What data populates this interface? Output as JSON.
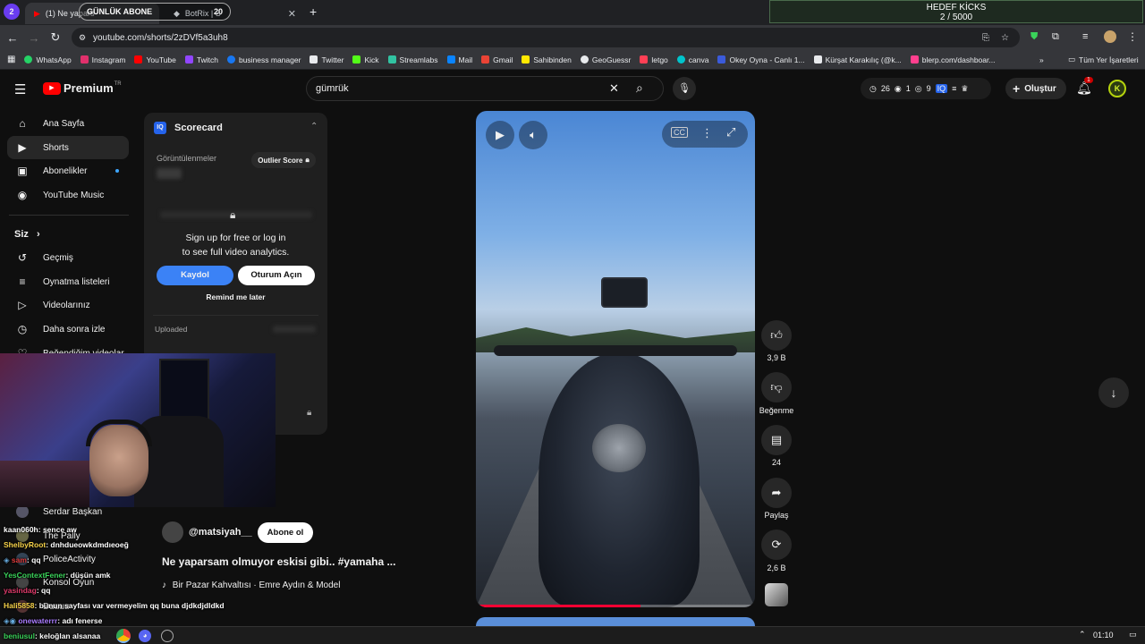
{
  "stream_overlay": {
    "badge_number": "2",
    "banner_label": "GÜNLÜK ABONE",
    "banner_count": "20",
    "goal_title": "HEDEF KİCKS",
    "goal_progress": "2 / 5000"
  },
  "browser": {
    "tabs": [
      {
        "label": "(1) Ne yapars",
        "active": true
      },
      {
        "label": "BotRix | S",
        "active": false
      }
    ],
    "url": "youtube.com/shorts/2zDVf5a3uh8",
    "bookmarks": [
      {
        "label": "WhatsApp",
        "color": "#25d366"
      },
      {
        "label": "Instagram",
        "color": "#e1306c"
      },
      {
        "label": "YouTube",
        "color": "#ff0000"
      },
      {
        "label": "Twitch",
        "color": "#9146ff"
      },
      {
        "label": "business manager",
        "color": "#1877f2"
      },
      {
        "label": "Twitter",
        "color": "#e8eaed"
      },
      {
        "label": "Kick",
        "color": "#53fc18"
      },
      {
        "label": "Streamlabs",
        "color": "#31c3a2"
      },
      {
        "label": "Mail",
        "color": "#0a84ff"
      },
      {
        "label": "Gmail",
        "color": "#ea4335"
      },
      {
        "label": "Sahibinden",
        "color": "#ffe800"
      },
      {
        "label": "GeoGuessr",
        "color": "#e8eaed"
      },
      {
        "label": "letgo",
        "color": "#ff3f55"
      },
      {
        "label": "canva",
        "color": "#00c4cc"
      },
      {
        "label": "Okey Oyna - Canlı 1...",
        "color": "#3b5bdb"
      },
      {
        "label": "Kürşat Karakılıç (@k...",
        "color": "#e8eaed"
      },
      {
        "label": "blerp.com/dashboar...",
        "color": "#ff3f8e"
      }
    ],
    "all_bookmarks": "Tüm Yer İşaretleri"
  },
  "youtube": {
    "logo": "Premium",
    "logo_region": "TR",
    "search_value": "gümrük",
    "header_stats": [
      "26",
      "1",
      "9"
    ],
    "create_label": "Oluştur",
    "notification_count": "1",
    "avatar_letter": "K",
    "sidebar": [
      {
        "label": "Ana Sayfa",
        "icon": "home-icon",
        "glyph": "⌂"
      },
      {
        "label": "Shorts",
        "icon": "shorts-icon",
        "glyph": "▶"
      },
      {
        "label": "Abonelikler",
        "icon": "subscriptions-icon",
        "glyph": "▣"
      },
      {
        "label": "YouTube Music",
        "icon": "music-icon",
        "glyph": "◉"
      }
    ],
    "you_label": "Siz",
    "you_items": [
      {
        "label": "Geçmiş",
        "icon": "history-icon",
        "glyph": "↺"
      },
      {
        "label": "Oynatma listeleri",
        "icon": "playlist-icon",
        "glyph": "≡"
      },
      {
        "label": "Videolarınız",
        "icon": "your-videos-icon",
        "glyph": "▷"
      },
      {
        "label": "Daha sonra izle",
        "icon": "watch-later-icon",
        "glyph": "◷"
      },
      {
        "label": "Beğendiğim videolar",
        "icon": "liked-icon",
        "glyph": "♡"
      }
    ],
    "subscriptions": [
      {
        "label": "Serdar Başkan"
      },
      {
        "label": "The Pally"
      },
      {
        "label": "PoliceActivity"
      },
      {
        "label": "Konsol Oyun"
      },
      {
        "label": "Duuuu"
      }
    ],
    "scorecard": {
      "title": "Scorecard",
      "views_label": "Görüntülenmeler",
      "outlier_label": "Outlier Score",
      "signup_line1": "Sign up for free or log in",
      "signup_line2": "to see full video analytics.",
      "signup_button": "Kaydol",
      "login_button": "Oturum Açın",
      "remind_label": "Remind me later",
      "uploaded_label": "Uploaded"
    },
    "short": {
      "channel": "@matsiyah__",
      "subscribe_label": "Abone ol",
      "title": "Ne yaparsam olmuyor eskisi gibi.. #yamaha ...",
      "music": "Bir Pazar Kahvaltısı · Emre Aydın & Model",
      "progress_fraction": 0.59
    },
    "actions": {
      "likes": "3,9 B",
      "dislike_label": "Beğenme",
      "comments": "24",
      "share_label": "Paylaş",
      "remix_count": "2,6 B"
    }
  },
  "chat": [
    {
      "user": "kaan060h",
      "message": ": sence aw",
      "color": "#ffffff"
    },
    {
      "user": "ShelbyRoot",
      "message": ": dnhdueowkdmdıeoeğ",
      "color": "#f7d34a"
    },
    {
      "user": "sam",
      "message": ": qq",
      "color": "#e03b3b"
    },
    {
      "user": "YesContextFener",
      "message": ": düşün amk",
      "color": "#3ad35a"
    },
    {
      "user": "yasindag",
      "message": ": qq",
      "color": "#e03b6b"
    },
    {
      "user": "Hali5858",
      "message": ": bunun sayfası var vermeyelim qq buna djdkdjdldkd",
      "color": "#f7d34a"
    },
    {
      "user": "onewaterrr",
      "message": ": adı fenerse",
      "color": "#a97bff"
    },
    {
      "user": "beniusul",
      "message": ": keloğlan alsanaa",
      "color": "#3ad35a"
    }
  ],
  "taskbar": {
    "clock": "01:10"
  }
}
